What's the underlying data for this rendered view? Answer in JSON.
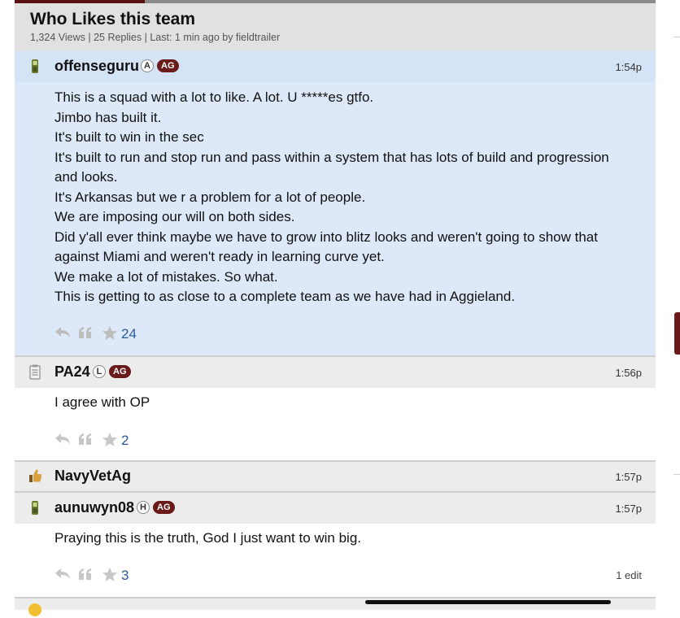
{
  "thread": {
    "title": "Who Likes this team",
    "meta": "1,324 Views | 25 Replies | Last: 1 min ago by fieldtrailer"
  },
  "posts": [
    {
      "username": "offenseguru",
      "badge_letter": "A",
      "badge_tag": "AG",
      "time": "1:54p",
      "device_icon": "phone-icon",
      "lines": [
        "This is a squad with a lot to like. A lot. U *****es gtfo.",
        "Jimbo has built it.",
        "It's built to win in the sec",
        "It's built to run and stop run and pass within a system that has lots of build and progression",
        "and looks.",
        "It's Arkansas but we r a problem for a lot of people.",
        "We are imposing our will on both sides.",
        "Did y'all ever think maybe we have to grow into blitz looks and weren't going to show that",
        "against Miami and weren't ready in learning curve yet.",
        "We make a lot of mistakes. So what.",
        "This is getting to as close to a complete team as we have had in Aggieland."
      ],
      "stars": "24"
    },
    {
      "username": "PA24",
      "badge_letter": "L",
      "badge_tag": "AG",
      "time": "1:56p",
      "device_icon": "notepad-icon",
      "lines": [
        "I agree with OP"
      ],
      "stars": "2"
    },
    {
      "username": "NavyVetAg",
      "time": "1:57p",
      "device_icon": "thumbs-up-icon"
    },
    {
      "username": "aunuwyn08",
      "badge_letter": "H",
      "badge_tag": "AG",
      "time": "1:57p",
      "device_icon": "phone-icon",
      "lines": [
        "Praying this is the truth, God I just want to win big."
      ],
      "stars": "3",
      "edit_note": "1 edit"
    }
  ],
  "colors": {
    "accent": "#6b1a1a",
    "op_background": "#dde9f8",
    "star_count": "#2a5a99"
  }
}
